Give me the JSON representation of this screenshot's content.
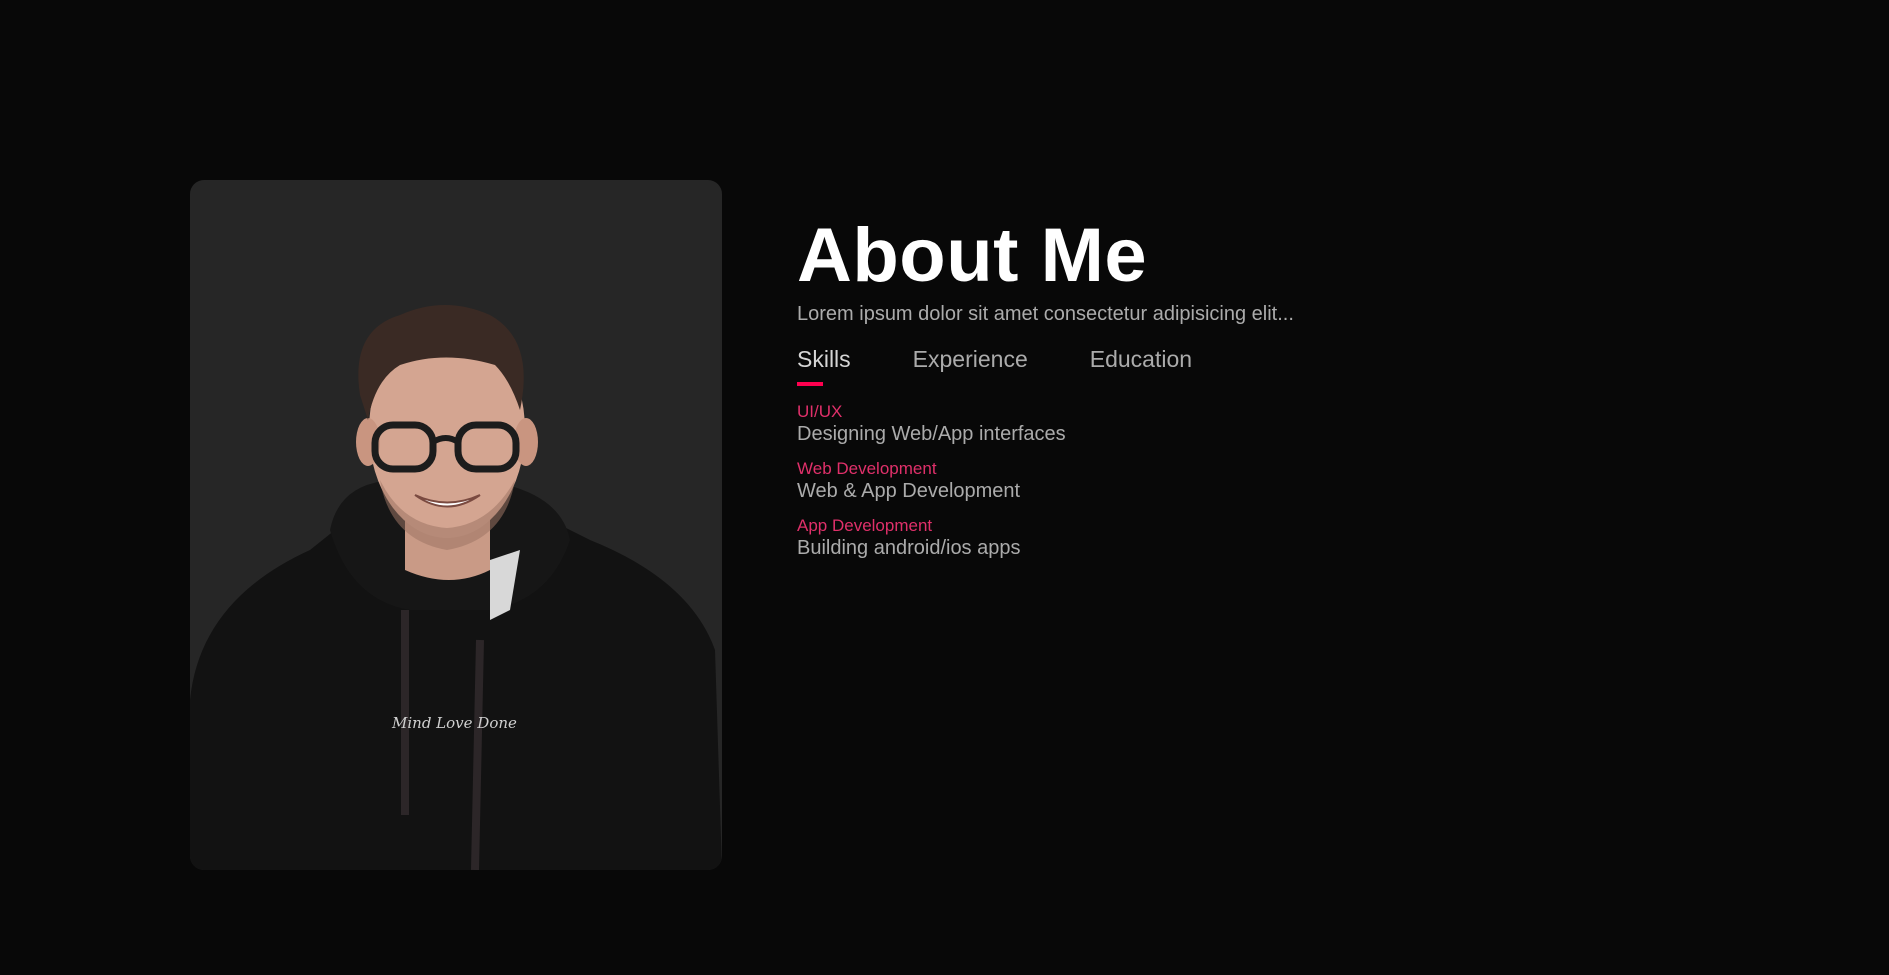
{
  "about": {
    "title": "About Me",
    "subtitle": "Lorem ipsum dolor sit amet consectetur adipisicing elit..."
  },
  "photo": {
    "alt": "profile-photo",
    "hoodie_text": "Mind Love Done"
  },
  "tabs": [
    {
      "label": "Skills",
      "active": true
    },
    {
      "label": "Experience",
      "active": false
    },
    {
      "label": "Education",
      "active": false
    }
  ],
  "skills": [
    {
      "name": "UI/UX",
      "desc": "Designing Web/App interfaces"
    },
    {
      "name": "Web Development",
      "desc": "Web & App Development"
    },
    {
      "name": "App Development",
      "desc": "Building android/ios apps"
    }
  ],
  "colors": {
    "background": "#080808",
    "card": "#262626",
    "accent": "#ff004f",
    "skill_name": "#e0306a",
    "text_muted": "#ababab"
  }
}
